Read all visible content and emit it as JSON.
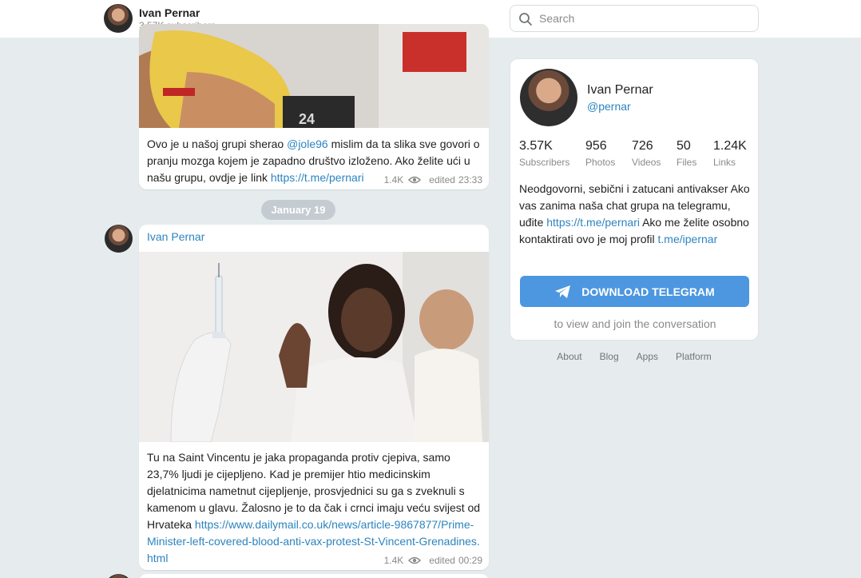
{
  "header": {
    "channel_name": "Ivan Pernar",
    "subscribers": "3.57K subscribers",
    "search_placeholder": "Search"
  },
  "posts": [
    {
      "text_a": "Ovo je u našoj grupi sherao ",
      "mention": "@jole96",
      "text_b": " mislim da ta slika sve govori o pranju mozga kojem je zapadno društvo izloženo. Ako želite ući u našu grupu, ovdje je link ",
      "link": "https://t.me/pernari",
      "views": "1.4K",
      "edited": "edited",
      "time": "23:33"
    },
    {
      "author": "Ivan Pernar",
      "text": "Tu na Saint Vincentu je jaka propaganda protiv cjepiva, samo 23,7% ljudi je cijepljeno. Kad je premijer htio medicinskim djelatnicima nametnut cijepljenje, prosvjednici su ga s zveknuli s kamenom u glavu. Žalosno je to da čak i crnci imaju veću svijest od Hrvateka",
      "link": "https://www.dailymail.co.uk/news/article-9867877/Prime-Minister-left-covered-blood-anti-vax-protest-St-Vincent-Grenadines.html",
      "views": "1.4K",
      "edited": "edited",
      "time": "00:29"
    }
  ],
  "date_separator": "January 19",
  "panel": {
    "name": "Ivan Pernar",
    "handle": "@pernar",
    "stats": [
      {
        "value": "3.57K",
        "label": "Subscribers"
      },
      {
        "value": "956",
        "label": "Photos"
      },
      {
        "value": "726",
        "label": "Videos"
      },
      {
        "value": "50",
        "label": "Files"
      },
      {
        "value": "1.24K",
        "label": "Links"
      }
    ],
    "desc_a": "Neodgovorni, sebični i zatucani antivakser Ako vas zanima naša chat grupa na telegramu, uđite ",
    "desc_link1": "https://t.me/pernari",
    "desc_b": " Ako me želite osobno kontaktirati ovo je moj profil ",
    "desc_link2": "t.me/ipernar",
    "download_label": "DOWNLOAD TELEGRAM",
    "note": "to view and join the conversation"
  },
  "footer": [
    "About",
    "Blog",
    "Apps",
    "Platform"
  ],
  "colors": {
    "accent": "#2c84bf",
    "button": "#4c97e0",
    "background": "#e6ebee"
  }
}
